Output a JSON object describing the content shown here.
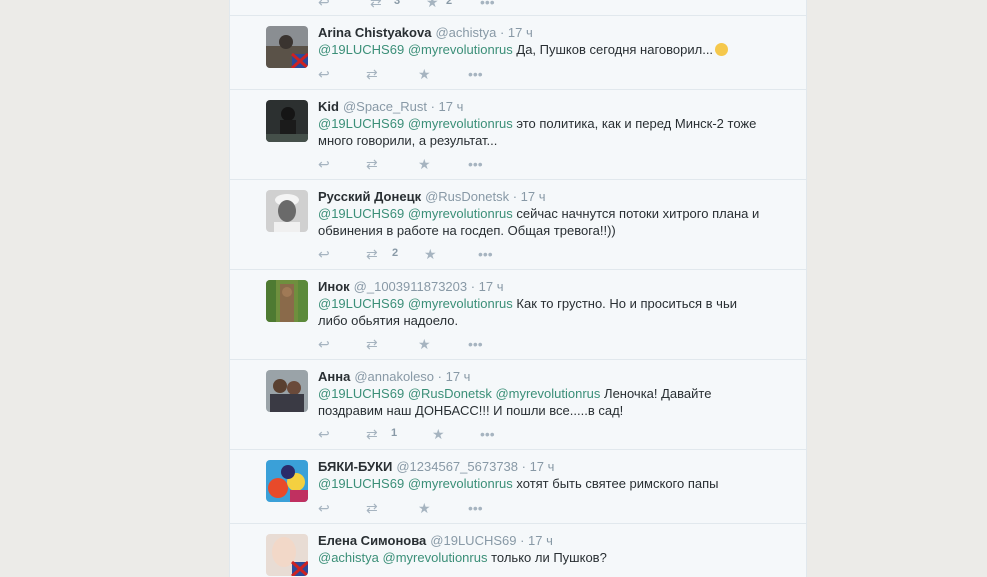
{
  "tweets": [
    {
      "name": "Arina Chistyakova",
      "handle": "@achistya",
      "time": "· 17 ч",
      "m1": "@19LUCHS69",
      "m2": "@myrevolutionrus",
      "m3": "",
      "text": "Да, Пушков сегодня наговорил...",
      "emoji": "surprised-emoji",
      "retweets": "",
      "likes": ""
    },
    {
      "name": "Kid",
      "handle": "@Space_Rust",
      "time": "· 17 ч",
      "m1": "@19LUCHS69",
      "m2": "@myrevolutionrus",
      "m3": "",
      "text": "это политика, как и перед Минск-2 тоже много говорили, а результат...",
      "retweets": "",
      "likes": ""
    },
    {
      "name": "Русский Донецк",
      "handle": "@RusDonetsk",
      "time": "· 17 ч",
      "m1": "@19LUCHS69",
      "m2": "@myrevolutionrus",
      "m3": "",
      "text": "сейчас начнутся потоки хитрого плана и обвинения в работе на госдеп. Общая тревога!!))",
      "retweets": "2",
      "likes": ""
    },
    {
      "name": "Инок",
      "handle": "@_1003911873203",
      "time": "· 17 ч",
      "m1": "@19LUCHS69",
      "m2": "@myrevolutionrus",
      "m3": "",
      "text": "Как то грустно. Но и проситься в чьи либо обьятия надоело.",
      "retweets": "",
      "likes": ""
    },
    {
      "name": "Анна",
      "handle": "@annakoleso",
      "time": "· 17 ч",
      "m1": "@19LUCHS69",
      "m2": "@RusDonetsk",
      "m3": "@myrevolutionrus",
      "text": "Леночка! Давайте поздравим наш ДОНБАСС!!! И пошли все.....в сад!",
      "retweets": "1",
      "likes": ""
    },
    {
      "name": "БЯКИ-БУКИ",
      "handle": "@1234567_5673738",
      "time": "· 17 ч",
      "m1": "@19LUCHS69",
      "m2": "@myrevolutionrus",
      "m3": "",
      "text": "хотят быть святее римского папы",
      "retweets": "",
      "likes": ""
    },
    {
      "name": "Елена Симонова",
      "handle": "@19LUCHS69",
      "time": "· 17 ч",
      "m1": "@achistya",
      "m2": "@myrevolutionrus",
      "m3": "",
      "text": "только ли Пушков?",
      "retweets": "",
      "likes": ""
    }
  ],
  "top_partial": {
    "retweets": "3",
    "likes": "2"
  },
  "icons": {
    "reply": "reply-icon",
    "retweet": "retweet-icon",
    "like": "star-icon",
    "more": "more-icon"
  },
  "colors": {
    "mention": "#3b8f78",
    "name": "#292f33",
    "meta": "#8899a6",
    "action": "#a6b4c0"
  }
}
